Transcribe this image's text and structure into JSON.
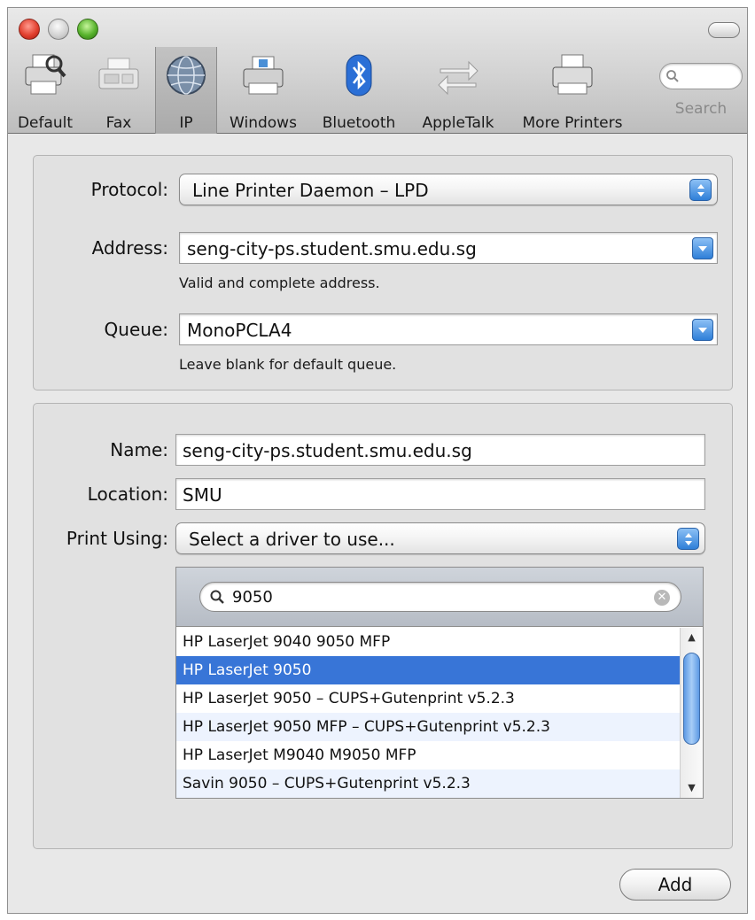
{
  "toolbar": {
    "items": [
      {
        "label": "Default",
        "icon": "printer-icon"
      },
      {
        "label": "Fax",
        "icon": "fax-icon"
      },
      {
        "label": "IP",
        "icon": "globe-icon"
      },
      {
        "label": "Windows",
        "icon": "windows-printer-icon"
      },
      {
        "label": "Bluetooth",
        "icon": "bluetooth-icon"
      },
      {
        "label": "AppleTalk",
        "icon": "appletalk-icon"
      },
      {
        "label": "More Printers",
        "icon": "more-printers-icon"
      }
    ],
    "search_label": "Search",
    "selected": "IP"
  },
  "connection": {
    "protocol_label": "Protocol:",
    "protocol_value": "Line Printer Daemon – LPD",
    "address_label": "Address:",
    "address_value": "seng-city-ps.student.smu.edu.sg",
    "address_hint": "Valid and complete address.",
    "queue_label": "Queue:",
    "queue_value": "MonoPCLA4",
    "queue_hint": "Leave blank for default queue."
  },
  "printer": {
    "name_label": "Name:",
    "name_value": "seng-city-ps.student.smu.edu.sg",
    "location_label": "Location:",
    "location_value": "SMU",
    "print_using_label": "Print Using:",
    "print_using_value": "Select a driver to use..."
  },
  "drivers": {
    "search_value": "9050",
    "items": [
      "HP LaserJet 9040 9050 MFP",
      "HP LaserJet 9050",
      "HP LaserJet 9050 – CUPS+Gutenprint v5.2.3",
      "HP LaserJet 9050 MFP – CUPS+Gutenprint v5.2.3",
      "HP LaserJet M9040 M9050 MFP",
      "Savin 9050 – CUPS+Gutenprint v5.2.3"
    ],
    "selected_index": 1
  },
  "actions": {
    "add_label": "Add"
  },
  "colors": {
    "selection": "#3875d7",
    "accent": "#2f7fd8"
  }
}
